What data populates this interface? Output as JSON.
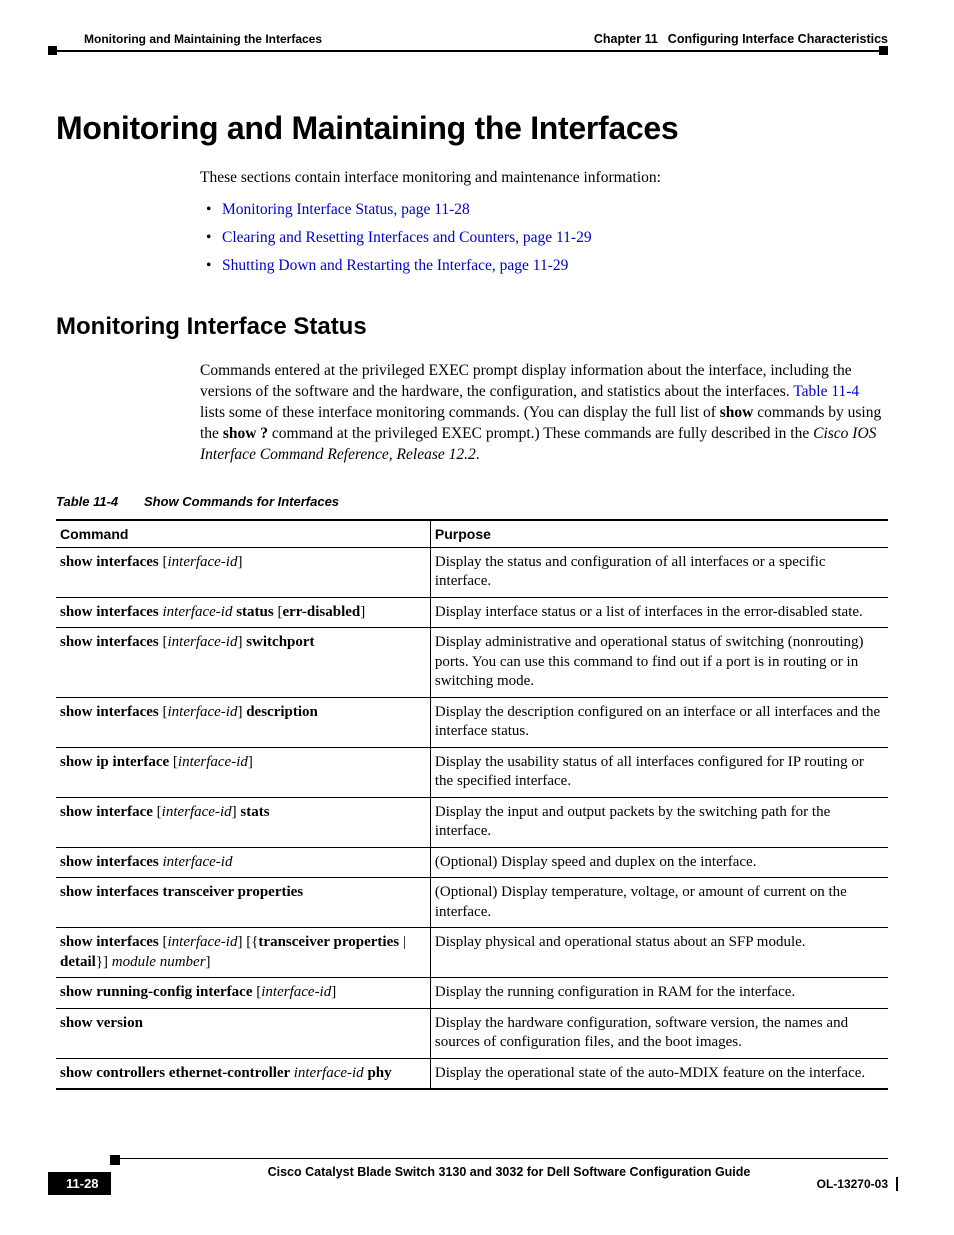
{
  "header": {
    "chapter_label": "Chapter 11",
    "chapter_title": "Configuring Interface Characteristics",
    "section": "Monitoring and Maintaining the Interfaces"
  },
  "main": {
    "h1": "Monitoring and Maintaining the Interfaces",
    "intro": "These sections contain interface monitoring and maintenance information:",
    "bullets": [
      "Monitoring Interface Status, page 11-28",
      "Clearing and Resetting Interfaces and Counters, page 11-29",
      "Shutting Down and Restarting the Interface, page 11-29"
    ],
    "h2": "Monitoring Interface Status",
    "para_parts": {
      "p1": "Commands entered at the privileged EXEC prompt display information about the interface, including the versions of the software and the hardware, the configuration, and statistics about the interfaces. ",
      "tlink": "Table 11-4",
      "p2": " lists some of these interface monitoring commands. (You can display the full list of ",
      "b1": "show",
      "p3": " commands by using the ",
      "b2": "show ?",
      "p4": " command at the privileged EXEC prompt.) These commands are fully described in the ",
      "i1": "Cisco IOS Interface Command Reference, Release 12.2",
      "p5": "."
    },
    "table_caption_num": "Table 11-4",
    "table_caption_title": "Show Commands for Interfaces",
    "table_headers": {
      "command": "Command",
      "purpose": "Purpose"
    },
    "rows": [
      {
        "cmd": [
          {
            "t": "show interfaces ",
            "s": "b"
          },
          {
            "t": "[",
            "s": ""
          },
          {
            "t": "interface-id",
            "s": "i"
          },
          {
            "t": "]",
            "s": ""
          }
        ],
        "purpose": "Display the status and configuration of all interfaces or a specific interface."
      },
      {
        "cmd": [
          {
            "t": "show interfaces ",
            "s": "b"
          },
          {
            "t": "interface-id ",
            "s": "i"
          },
          {
            "t": "status ",
            "s": "b"
          },
          {
            "t": "[",
            "s": ""
          },
          {
            "t": "err-disabled",
            "s": "b"
          },
          {
            "t": "]",
            "s": ""
          }
        ],
        "purpose": "Display interface status or a list of interfaces in the error-disabled state."
      },
      {
        "cmd": [
          {
            "t": "show interfaces ",
            "s": "b"
          },
          {
            "t": "[",
            "s": ""
          },
          {
            "t": "interface-id",
            "s": "i"
          },
          {
            "t": "] ",
            "s": ""
          },
          {
            "t": "switchport",
            "s": "b"
          }
        ],
        "purpose": "Display administrative and operational status of switching (nonrouting) ports. You can use this command to find out if a port is in routing or in switching mode."
      },
      {
        "cmd": [
          {
            "t": "show interfaces ",
            "s": "b"
          },
          {
            "t": "[",
            "s": ""
          },
          {
            "t": "interface-id",
            "s": "i"
          },
          {
            "t": "] ",
            "s": ""
          },
          {
            "t": "description",
            "s": "b"
          }
        ],
        "purpose": "Display the description configured on an interface or all interfaces and the interface status."
      },
      {
        "cmd": [
          {
            "t": "show ip interface ",
            "s": "b"
          },
          {
            "t": "[",
            "s": ""
          },
          {
            "t": "interface-id",
            "s": "i"
          },
          {
            "t": "]",
            "s": ""
          }
        ],
        "purpose": "Display the usability status of all interfaces configured for IP routing or the specified interface."
      },
      {
        "cmd": [
          {
            "t": "show interface ",
            "s": "b"
          },
          {
            "t": "[",
            "s": ""
          },
          {
            "t": "interface-id",
            "s": "i"
          },
          {
            "t": "] ",
            "s": ""
          },
          {
            "t": "stats",
            "s": "b"
          }
        ],
        "purpose": "Display the input and output packets by the switching path for the interface."
      },
      {
        "cmd": [
          {
            "t": "show interfaces ",
            "s": "b"
          },
          {
            "t": "interface-id",
            "s": "i"
          }
        ],
        "purpose": "(Optional) Display speed and duplex on the interface."
      },
      {
        "cmd": [
          {
            "t": "show interfaces transceiver properties",
            "s": "b"
          }
        ],
        "purpose": "(Optional) Display temperature, voltage, or amount of current on the interface."
      },
      {
        "cmd": [
          {
            "t": "show interfaces ",
            "s": "b"
          },
          {
            "t": "[",
            "s": ""
          },
          {
            "t": "interface-id",
            "s": "i"
          },
          {
            "t": "] [{",
            "s": ""
          },
          {
            "t": "transceiver properties",
            "s": "b"
          },
          {
            "t": " | ",
            "s": ""
          },
          {
            "t": "detail",
            "s": "b"
          },
          {
            "t": "}] ",
            "s": ""
          },
          {
            "t": "module number",
            "s": "i"
          },
          {
            "t": "]",
            "s": ""
          }
        ],
        "purpose": "Display physical and operational status about an SFP module."
      },
      {
        "cmd": [
          {
            "t": "show running-config interface ",
            "s": "b"
          },
          {
            "t": "[",
            "s": ""
          },
          {
            "t": "interface-id",
            "s": "i"
          },
          {
            "t": "]",
            "s": ""
          }
        ],
        "purpose": "Display the running configuration in RAM for the interface."
      },
      {
        "cmd": [
          {
            "t": "show version",
            "s": "b"
          }
        ],
        "purpose": "Display the hardware configuration, software version, the names and sources of configuration files, and the boot images."
      },
      {
        "cmd": [
          {
            "t": "show controllers ethernet-controller ",
            "s": "b"
          },
          {
            "t": "interface-id ",
            "s": "i"
          },
          {
            "t": "phy",
            "s": "b"
          }
        ],
        "purpose": "Display the operational state of the auto-MDIX feature on the interface."
      }
    ]
  },
  "footer": {
    "book_title": "Cisco Catalyst Blade Switch 3130 and 3032 for Dell Software Configuration Guide",
    "page_number": "11-28",
    "doc_id": "OL-13270-03"
  }
}
